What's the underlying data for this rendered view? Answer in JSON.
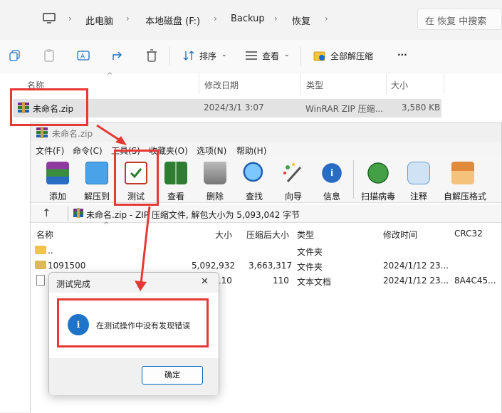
{
  "explorer": {
    "breadcrumbs": [
      "此电脑",
      "本地磁盘 (F:)",
      "Backup",
      "恢复"
    ],
    "search_placeholder": "在 恢复 中搜索",
    "commands": {
      "sort": "排序",
      "view": "查看",
      "extract_all": "全部解压缩",
      "more": "···"
    },
    "columns": [
      "名称",
      "修改日期",
      "类型",
      "大小"
    ],
    "file": {
      "name": "未命名.zip",
      "modified": "2024/3/1 3:07",
      "type": "WinRAR ZIP 压缩...",
      "size": "3,580 KB"
    }
  },
  "winrar": {
    "title": "未命名.zip",
    "menu": [
      "文件(F)",
      "命令(C)",
      "工具(S)",
      "收藏夹(O)",
      "选项(N)",
      "帮助(H)"
    ],
    "tools": [
      "添加",
      "解压到",
      "测试",
      "查看",
      "删除",
      "查找",
      "向导",
      "信息",
      "扫描病毒",
      "注释",
      "自解压格式"
    ],
    "path_text": "未命名.zip - ZIP 压缩文件, 解包大小为 5,093,042 字节",
    "columns": [
      "名称",
      "大小",
      "压缩后大小",
      "类型",
      "修改时间",
      "CRC32"
    ],
    "rows": [
      {
        "name": "..",
        "size": "",
        "packed": "",
        "type": "文件夹",
        "modified": "",
        "crc": ""
      },
      {
        "name": "1091500",
        "size": "5,092,932",
        "packed": "3,663,317",
        "type": "文件夹",
        "modified": "2024/1/12 23...",
        "crc": ""
      },
      {
        "name": "",
        "size": "110",
        "packed": "110",
        "type": "文本文档",
        "modified": "2024/1/12 23...",
        "crc": "8A4C45..."
      }
    ]
  },
  "dialog": {
    "title": "测试完成",
    "message": "在测试操作中没有发现错误",
    "ok_label": "确定",
    "close_glyph": "✕"
  },
  "colors": {
    "accent": "#0067c0",
    "highlight": "#e53935",
    "selection": "#e3e3e3"
  }
}
